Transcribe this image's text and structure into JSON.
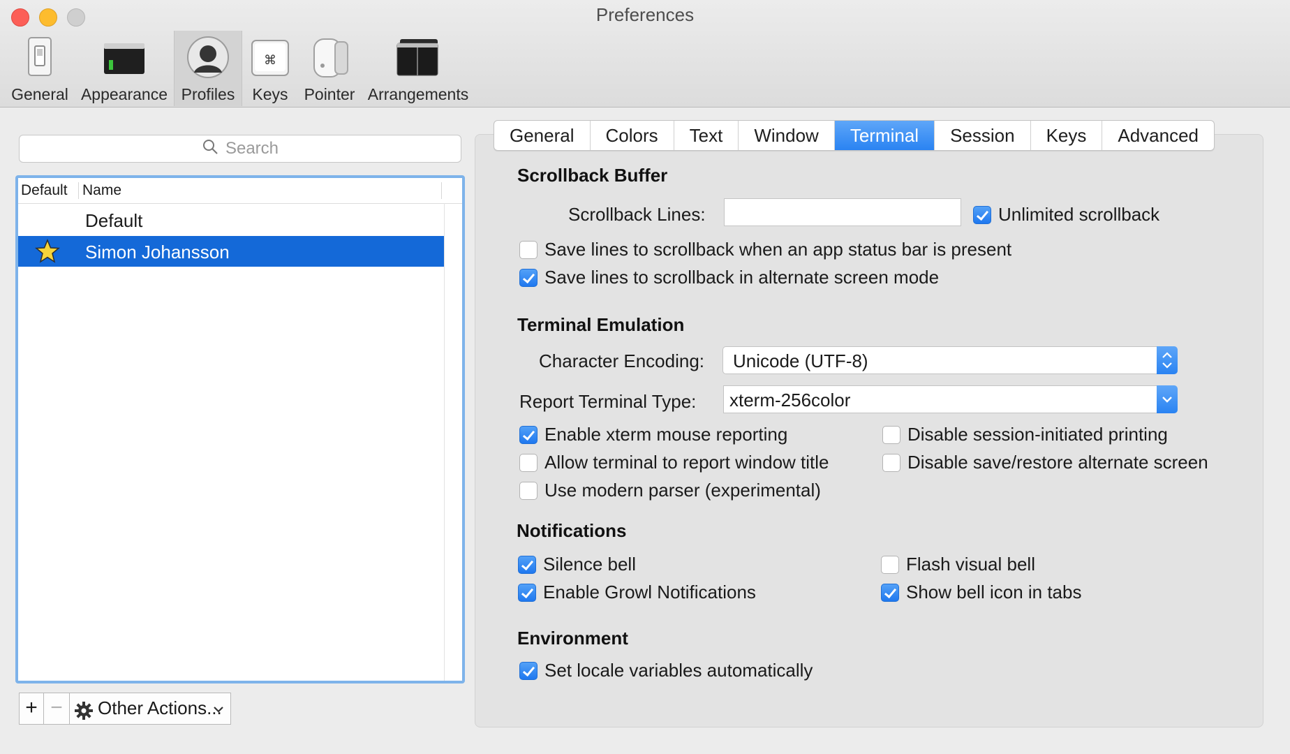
{
  "window": {
    "title": "Preferences"
  },
  "toolbar": {
    "items": [
      {
        "label": "General",
        "icon": "switch-icon"
      },
      {
        "label": "Appearance",
        "icon": "window-appearance-icon"
      },
      {
        "label": "Profiles",
        "icon": "user-silhouette-icon"
      },
      {
        "label": "Keys",
        "icon": "command-key-icon"
      },
      {
        "label": "Pointer",
        "icon": "mouse-icon"
      },
      {
        "label": "Arrangements",
        "icon": "window-arrangement-icon"
      }
    ],
    "selected": "Profiles"
  },
  "profiles": {
    "search_placeholder": "Search",
    "columns": {
      "default": "Default",
      "name": "Name"
    },
    "rows": [
      {
        "name": "Default",
        "is_default": false,
        "selected": false
      },
      {
        "name": "Simon Johansson",
        "is_default": true,
        "selected": true
      }
    ],
    "add_label": "+",
    "remove_label": "−",
    "other_actions_label": "Other Actions..."
  },
  "tabs": {
    "items": [
      "General",
      "Colors",
      "Text",
      "Window",
      "Terminal",
      "Session",
      "Keys",
      "Advanced"
    ],
    "active": "Terminal"
  },
  "scrollback": {
    "title": "Scrollback Buffer",
    "lines_label": "Scrollback Lines:",
    "lines_value": "",
    "unlimited": {
      "label": "Unlimited scrollback",
      "checked": true
    },
    "save_status_bar": {
      "label": "Save lines to scrollback when an app status bar is present",
      "checked": false
    },
    "save_alternate": {
      "label": "Save lines to scrollback in alternate screen mode",
      "checked": true
    }
  },
  "emulation": {
    "title": "Terminal Emulation",
    "encoding_label": "Character Encoding:",
    "encoding_value": "Unicode (UTF-8)",
    "type_label": "Report Terminal Type:",
    "type_value": "xterm-256color",
    "options": {
      "xterm_mouse": {
        "label": "Enable xterm mouse reporting",
        "checked": true
      },
      "report_title": {
        "label": "Allow terminal to report window title",
        "checked": false
      },
      "modern_parser": {
        "label": "Use modern parser (experimental)",
        "checked": false
      },
      "disable_printing": {
        "label": "Disable session-initiated printing",
        "checked": false
      },
      "disable_alt_screen": {
        "label": "Disable save/restore alternate screen",
        "checked": false
      }
    }
  },
  "notifications": {
    "title": "Notifications",
    "silence_bell": {
      "label": "Silence bell",
      "checked": true
    },
    "growl": {
      "label": "Enable Growl Notifications",
      "checked": true
    },
    "flash_bell": {
      "label": "Flash visual bell",
      "checked": false
    },
    "bell_icon": {
      "label": "Show bell icon in tabs",
      "checked": true
    }
  },
  "environment": {
    "title": "Environment",
    "locale": {
      "label": "Set locale variables automatically",
      "checked": true
    }
  },
  "colors": {
    "accent": "#2a83f2",
    "selection": "#1469d8",
    "list_focus_ring": "#7eb3ea"
  }
}
